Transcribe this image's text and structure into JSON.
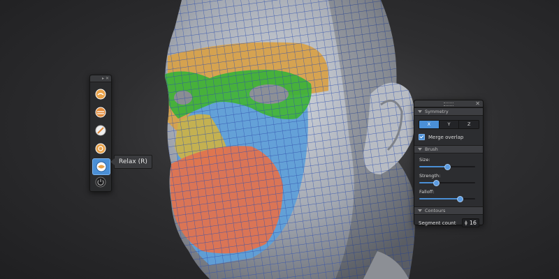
{
  "canvas": {
    "subject": "3D head mesh with colored polygroups",
    "colors": {
      "background": "#2e2e30",
      "skin": "#b7bcc4",
      "wireframe": "#3a5fbf",
      "forehead_group": "#d7a14a",
      "eye_group": "#3fb23a",
      "cheek_group": "#5f9fd8",
      "nose_group": "#c9b24a",
      "mouth_group": "#e0734f"
    }
  },
  "toolbar": {
    "tools": [
      {
        "icon": "sculpt-brush-icon",
        "color": "#e8a24a"
      },
      {
        "icon": "smooth-brush-icon",
        "color": "#e08a3a"
      },
      {
        "icon": "pinch-brush-icon",
        "color": "#f0f0f0"
      },
      {
        "icon": "inflate-brush-icon",
        "color": "#e8a24a"
      },
      {
        "icon": "relax-brush-icon",
        "color": "#4a8fd6",
        "active": true
      },
      {
        "icon": "power-icon",
        "color": "#888888"
      }
    ],
    "tooltip": "Relax (R)"
  },
  "panel": {
    "symmetry": {
      "title": "Symmetry",
      "axes": [
        "X",
        "Y",
        "Z"
      ],
      "active_axis": "X",
      "merge_label": "Merge overlap",
      "merge_checked": true
    },
    "brush": {
      "title": "Brush",
      "size_label": "Size:",
      "size_value": 0.5,
      "strength_label": "Strength:",
      "strength_value": 0.3,
      "falloff_label": "Falloff:",
      "falloff_value": 0.72
    },
    "contours": {
      "title": "Contours",
      "segment_label": "Segment count",
      "segment_value": "16"
    },
    "accent": "#4a8fd6"
  }
}
